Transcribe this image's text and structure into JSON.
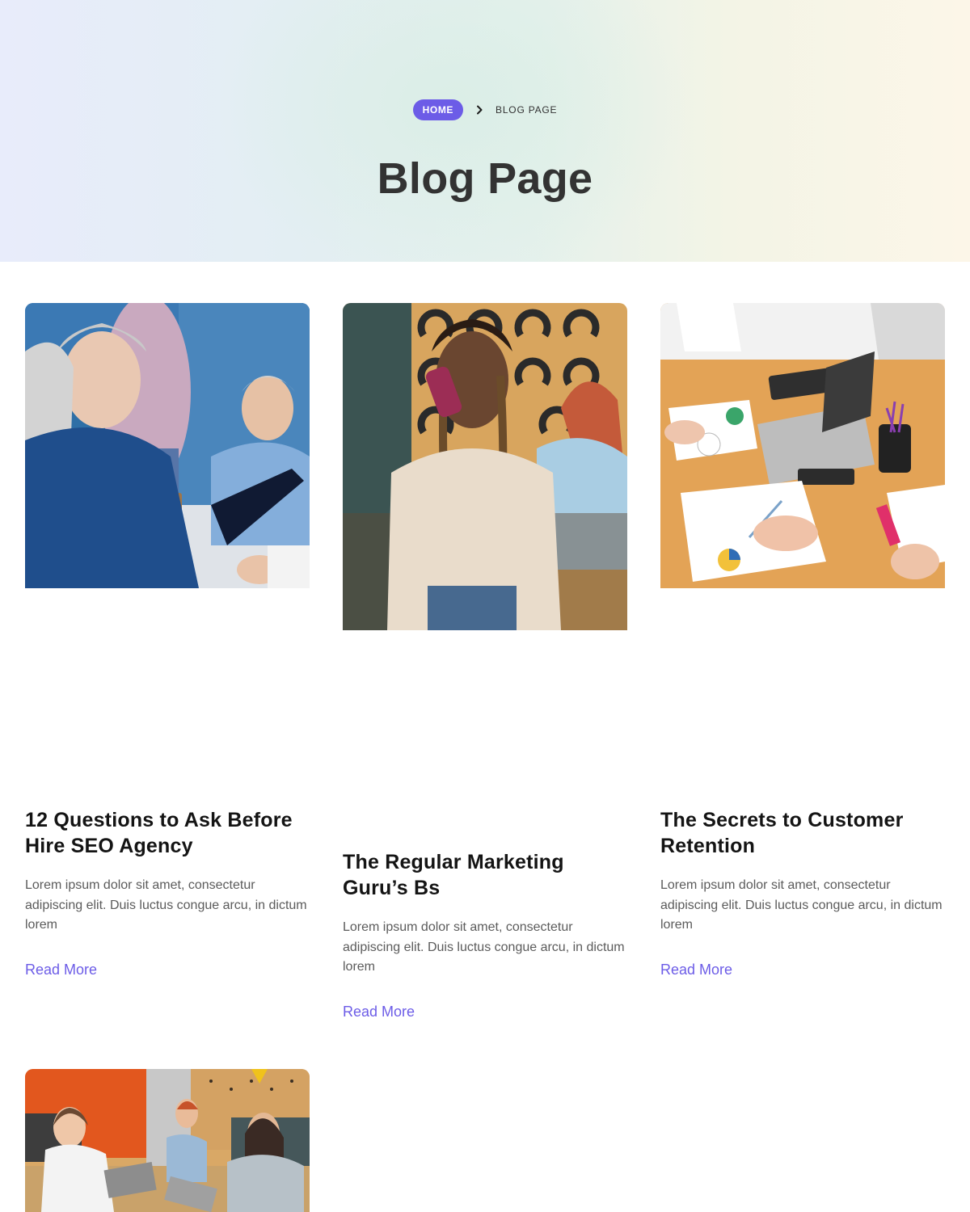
{
  "breadcrumb": {
    "home": "HOME",
    "current": "BLOG PAGE"
  },
  "page": {
    "title": "Blog Page"
  },
  "posts": [
    {
      "title": "12 Questions to Ask Before Hire SEO Agency",
      "excerpt": "Lorem ipsum dolor sit amet, consectetur adipiscing elit. Duis luctus congue arcu, in dictum lorem",
      "cta": "Read More"
    },
    {
      "title": "The Regular Marketing Guru’s Bs",
      "excerpt": "Lorem ipsum dolor sit amet, consectetur adipiscing elit. Duis luctus congue arcu, in dictum lorem",
      "cta": "Read More"
    },
    {
      "title": "The Secrets to Customer Retention",
      "excerpt": "Lorem ipsum dolor sit amet, consectetur adipiscing elit. Duis luctus congue arcu, in dictum lorem",
      "cta": "Read More"
    }
  ],
  "colors": {
    "accent": "#6c5ce7",
    "heading": "#333333",
    "body_text": "#5b5b5b"
  }
}
